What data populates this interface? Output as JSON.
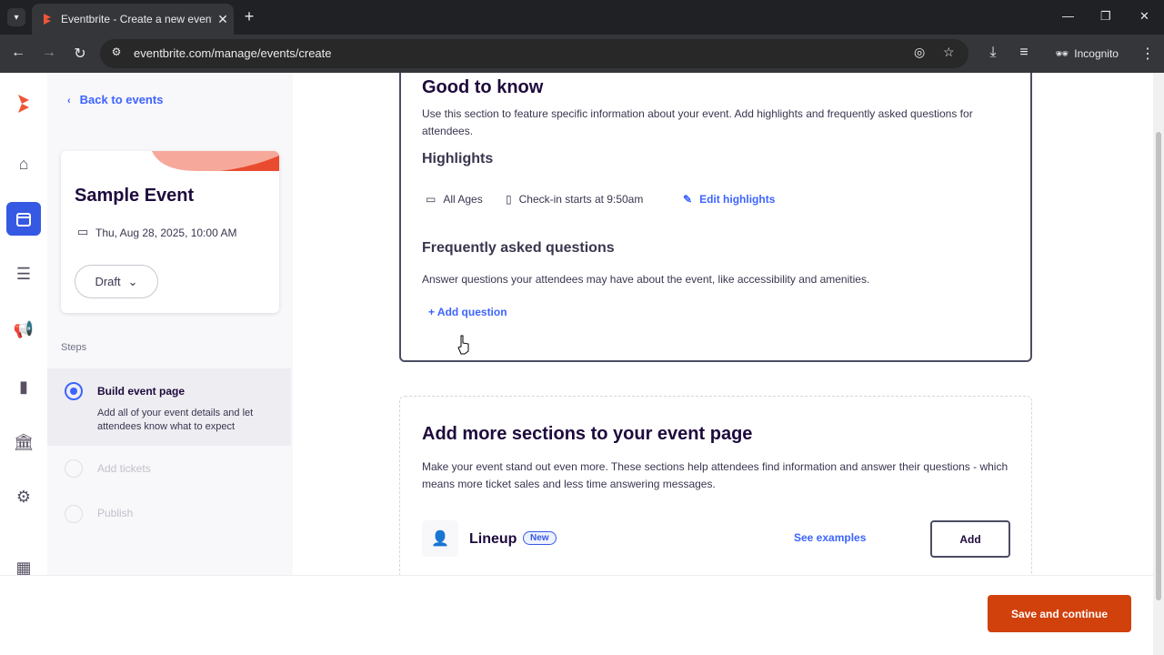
{
  "browser": {
    "tab_title": "Eventbrite - Create a new event",
    "url": "eventbrite.com/manage/events/create",
    "incognito_label": "Incognito"
  },
  "sidebar": {
    "back_label": "Back to events",
    "event_name": "Sample Event",
    "event_date": "Thu, Aug 28, 2025, 10:00 AM",
    "status": "Draft",
    "steps_label": "Steps",
    "steps": [
      {
        "title": "Build event page",
        "desc": "Add all of your event details and let attendees know what to expect"
      },
      {
        "title": "Add tickets"
      },
      {
        "title": "Publish"
      }
    ]
  },
  "good_to_know": {
    "title": "Good to know",
    "desc": "Use this section to feature specific information about your event. Add highlights and frequently asked questions for attendees.",
    "highlights_title": "Highlights",
    "highlights": [
      "All Ages",
      "Check-in starts at 9:50am"
    ],
    "edit_highlights": "Edit highlights",
    "faq_title": "Frequently asked questions",
    "faq_desc": "Answer questions your attendees may have about the event, like accessibility and amenities.",
    "add_question": "+ Add question"
  },
  "more_sections": {
    "title": "Add more sections to your event page",
    "desc": "Make your event stand out even more. These sections help attendees find information and answer their questions - which means more ticket sales and less time answering messages.",
    "lineup_label": "Lineup",
    "new_badge": "New",
    "see_examples": "See examples",
    "add_label": "Add"
  },
  "footer": {
    "save_label": "Save and continue"
  },
  "colors": {
    "brand": "#d1410c",
    "accent": "#3d64ff",
    "active_rail": "#3659e3"
  }
}
